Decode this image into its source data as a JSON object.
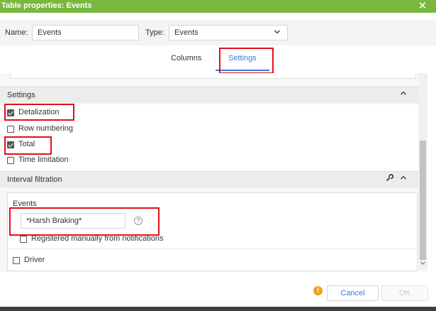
{
  "window": {
    "title": "Table properties: Events",
    "close_glyph": "✕"
  },
  "form": {
    "name_label": "Name:",
    "name_value": "Events",
    "type_label": "Type:",
    "type_value": "Events"
  },
  "tabs": [
    {
      "label": "Columns",
      "active": false
    },
    {
      "label": "Settings",
      "active": true
    }
  ],
  "settings": {
    "title": "Settings",
    "options": [
      {
        "label": "Detalization",
        "checked": true
      },
      {
        "label": "Row numbering",
        "checked": false
      },
      {
        "label": "Total",
        "checked": true
      },
      {
        "label": "Time limitation",
        "checked": false
      }
    ]
  },
  "interval": {
    "title": "Interval filtration",
    "events_label": "Events",
    "events_mask": "*Harsh Braking*",
    "help_glyph": "?",
    "registered_manually_label": "Registered manually from notifications",
    "registered_manually_checked": false,
    "driver_label": "Driver",
    "driver_checked": false
  },
  "footer": {
    "warning_glyph": "!",
    "cancel_label": "Cancel",
    "ok_label": "OK"
  },
  "colors": {
    "accent": "#78b83f",
    "link": "#2f7fe0",
    "highlight": "#e0101a",
    "warning": "#f0a019"
  },
  "icons": [
    "close-icon",
    "chevron-down-icon",
    "chevron-up-icon",
    "wrench-icon",
    "help-icon",
    "warning-icon"
  ]
}
